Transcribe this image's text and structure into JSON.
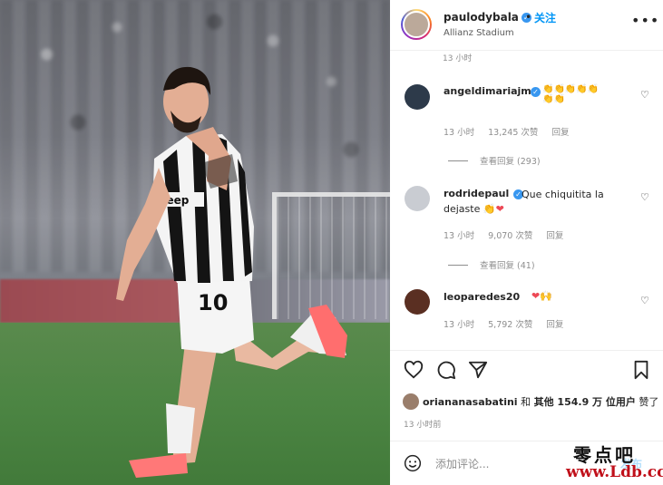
{
  "header": {
    "username": "paulodybala",
    "dot": "•",
    "follow_label": "关注",
    "location": "Allianz Stadium",
    "more_icon": "more-options-icon"
  },
  "comments": {
    "top_time": "13 小时",
    "items": [
      {
        "username": "angeldimariajm",
        "text": "👏👏👏👏👏👏👏",
        "time": "13 小时",
        "likes": "13,245 次赞",
        "reply": "回复",
        "view_replies": "查看回复 (293)",
        "avatar_color": "#2d3a4a"
      },
      {
        "username": "rodridepaul",
        "text": "Que chiquitita la dejaste 👏❤️",
        "time": "13 小时",
        "likes": "9,070 次赞",
        "reply": "回复",
        "view_replies": "查看回复 (41)",
        "avatar_color": "#c9ccd2"
      },
      {
        "username": "leoparedes20",
        "text": "❤️🙌",
        "time": "13 小时",
        "likes": "5,792 次赞",
        "reply": "回复",
        "view_replies": "",
        "avatar_color": "#5a2f22"
      }
    ]
  },
  "likes": {
    "liker": "oriananasabatini",
    "text_mid": " 和 ",
    "others": "其他 154.9 万 位用户",
    "text_end": " 赞了"
  },
  "post_time": "13 小时前",
  "add_comment": {
    "placeholder": "添加评论...",
    "post_label": "发布"
  },
  "watermark": {
    "line1": "零点吧",
    "line2": "www.Ldb.cc"
  },
  "colors": {
    "accent": "#0095f6",
    "verified": "#3897f0",
    "heart": "#ed4956"
  }
}
